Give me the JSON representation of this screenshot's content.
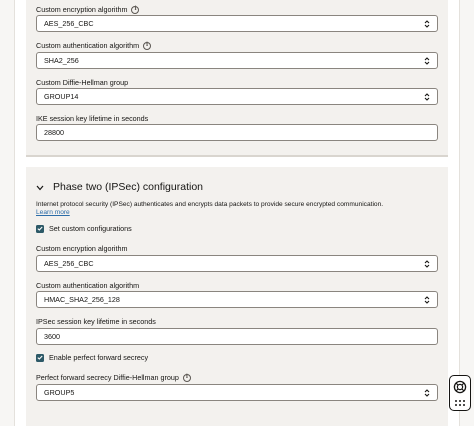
{
  "phase_one": {
    "enc_label": "Custom encryption algorithm",
    "enc_value": "AES_256_CBC",
    "auth_label": "Custom authentication algorithm",
    "auth_value": "SHA2_256",
    "dh_label": "Custom Diffie-Hellman group",
    "dh_value": "GROUP14",
    "lifetime_label": "IKE session key lifetime in seconds",
    "lifetime_value": "28800"
  },
  "phase_two": {
    "title": "Phase two (IPSec) configuration",
    "description": "Internet protocol security (IPSec) authenticates and encrypts data packets to provide secure encrypted communication.",
    "learn_more": "Learn more",
    "custom_config_label": "Set custom configurations",
    "custom_config_checked": true,
    "enc_label": "Custom encryption algorithm",
    "enc_value": "AES_256_CBC",
    "auth_label": "Custom authentication algorithm",
    "auth_value": "HMAC_SHA2_256_128",
    "lifetime_label": "IPSec session key lifetime in seconds",
    "lifetime_value": "3600",
    "pfs_label": "Enable perfect forward secrecy",
    "pfs_checked": true,
    "pfs_group_label": "Perfect forward secrecy Diffie-Hellman group",
    "pfs_group_value": "GROUP5"
  },
  "icons": {
    "info": "info-icon",
    "select_arrows": "updown-chevron-icon",
    "collapse": "chevron-down-icon",
    "check": "checkmark-icon",
    "help": "help-assistant-icon"
  },
  "colors": {
    "panel_bg": "#f3f1ee",
    "checkbox": "#2c5967",
    "link": "#2b6ca8"
  }
}
